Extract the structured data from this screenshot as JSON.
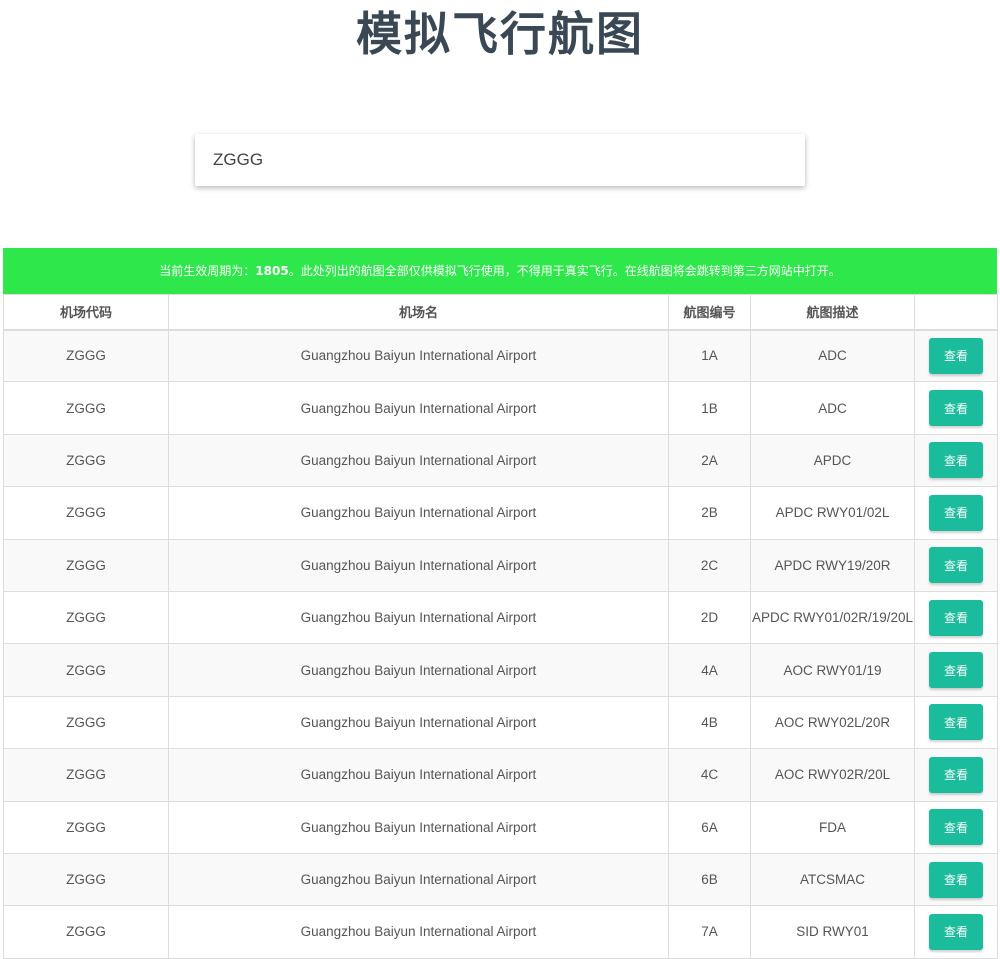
{
  "page": {
    "title": "模拟飞行航图"
  },
  "search": {
    "value": "ZGGG",
    "placeholder": ""
  },
  "notice": {
    "prefix": "当前生效周期为：",
    "cycle": "1805",
    "suffix": "。此处列出的航图全部仅供模拟飞行使用，不得用于真实飞行。在线航图将会跳转到第三方网站中打开。"
  },
  "colors": {
    "notice_bg": "#2ee84b",
    "button_bg": "#1abc9c",
    "title": "#3a4856"
  },
  "table": {
    "headers": {
      "code": "机场代码",
      "name": "机场名",
      "chart_no": "航图编号",
      "desc": "航图描述",
      "action": ""
    },
    "view_label": "查看",
    "rows": [
      {
        "code": "ZGGG",
        "name": "Guangzhou Baiyun International Airport",
        "chart_no": "1A",
        "desc": "ADC"
      },
      {
        "code": "ZGGG",
        "name": "Guangzhou Baiyun International Airport",
        "chart_no": "1B",
        "desc": "ADC"
      },
      {
        "code": "ZGGG",
        "name": "Guangzhou Baiyun International Airport",
        "chart_no": "2A",
        "desc": "APDC"
      },
      {
        "code": "ZGGG",
        "name": "Guangzhou Baiyun International Airport",
        "chart_no": "2B",
        "desc": "APDC RWY01/02L"
      },
      {
        "code": "ZGGG",
        "name": "Guangzhou Baiyun International Airport",
        "chart_no": "2C",
        "desc": "APDC RWY19/20R"
      },
      {
        "code": "ZGGG",
        "name": "Guangzhou Baiyun International Airport",
        "chart_no": "2D",
        "desc": "APDC RWY01/02R/19/20L"
      },
      {
        "code": "ZGGG",
        "name": "Guangzhou Baiyun International Airport",
        "chart_no": "4A",
        "desc": "AOC RWY01/19"
      },
      {
        "code": "ZGGG",
        "name": "Guangzhou Baiyun International Airport",
        "chart_no": "4B",
        "desc": "AOC RWY02L/20R"
      },
      {
        "code": "ZGGG",
        "name": "Guangzhou Baiyun International Airport",
        "chart_no": "4C",
        "desc": "AOC RWY02R/20L"
      },
      {
        "code": "ZGGG",
        "name": "Guangzhou Baiyun International Airport",
        "chart_no": "6A",
        "desc": "FDA"
      },
      {
        "code": "ZGGG",
        "name": "Guangzhou Baiyun International Airport",
        "chart_no": "6B",
        "desc": "ATCSMAC"
      },
      {
        "code": "ZGGG",
        "name": "Guangzhou Baiyun International Airport",
        "chart_no": "7A",
        "desc": "SID RWY01"
      }
    ]
  }
}
